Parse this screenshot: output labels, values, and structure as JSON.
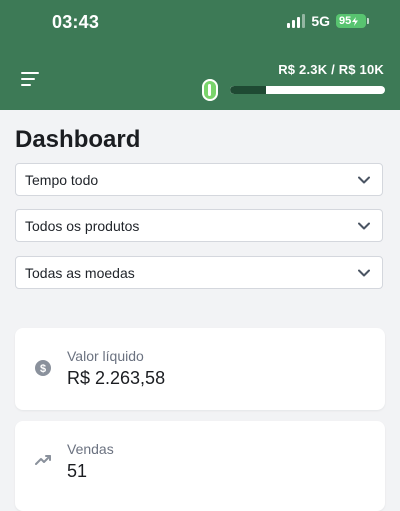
{
  "status_bar": {
    "time": "03:43",
    "network": "5G",
    "battery": "95"
  },
  "header": {
    "revenue_text": "R$ 2.3K / R$ 10K",
    "progress_fraction": 0.23
  },
  "page": {
    "title": "Dashboard"
  },
  "filters": {
    "period": "Tempo todo",
    "products": "Todos os produtos",
    "currencies": "Todas as moedas"
  },
  "cards": [
    {
      "label": "Valor líquido",
      "value": "R$ 2.263,58",
      "icon": "dollar-circle-icon"
    },
    {
      "label": "Vendas",
      "value": "51",
      "icon": "trending-up-icon"
    }
  ],
  "colors": {
    "header_bg": "#3d7a56",
    "battery_green": "#58c470",
    "progress_fill": "#1f4a33"
  }
}
